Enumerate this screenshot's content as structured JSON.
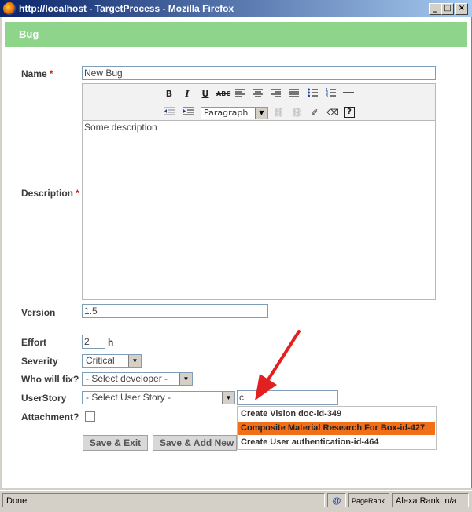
{
  "window": {
    "title": "http://localhost - TargetProcess - Mozilla Firefox"
  },
  "header": {
    "title": "Bug"
  },
  "form": {
    "name": {
      "label": "Name",
      "required_mark": "*",
      "value": "New Bug"
    },
    "description": {
      "label": "Description",
      "required_mark": "*",
      "value": "Some description"
    },
    "toolbar": {
      "paragraph_format": "Paragraph"
    },
    "version": {
      "label": "Version",
      "value": "1.5"
    },
    "effort": {
      "label": "Effort",
      "value": "2",
      "unit": "h"
    },
    "severity": {
      "label": "Severity",
      "value": "Critical"
    },
    "who_will_fix": {
      "label": "Who will fix?",
      "value": "- Select developer -"
    },
    "userstory": {
      "label": "UserStory",
      "value": "- Select User Story -",
      "search_value": "c"
    },
    "attachment": {
      "label": "Attachment?"
    }
  },
  "suggestions": [
    "Create Vision doc-id-349",
    "Composite Material Research For Box-id-427",
    "Create User authentication-id-464"
  ],
  "buttons": {
    "save_exit": "Save & Exit",
    "save_add_new": "Save & Add New"
  },
  "statusbar": {
    "status": "Done",
    "pagerank": "PageRank",
    "alexa": "Alexa Rank: n/a"
  },
  "colors": {
    "header_bg": "#8ed48a",
    "suggestion_highlight": "#f26f1a",
    "arrow": "#e32020"
  }
}
